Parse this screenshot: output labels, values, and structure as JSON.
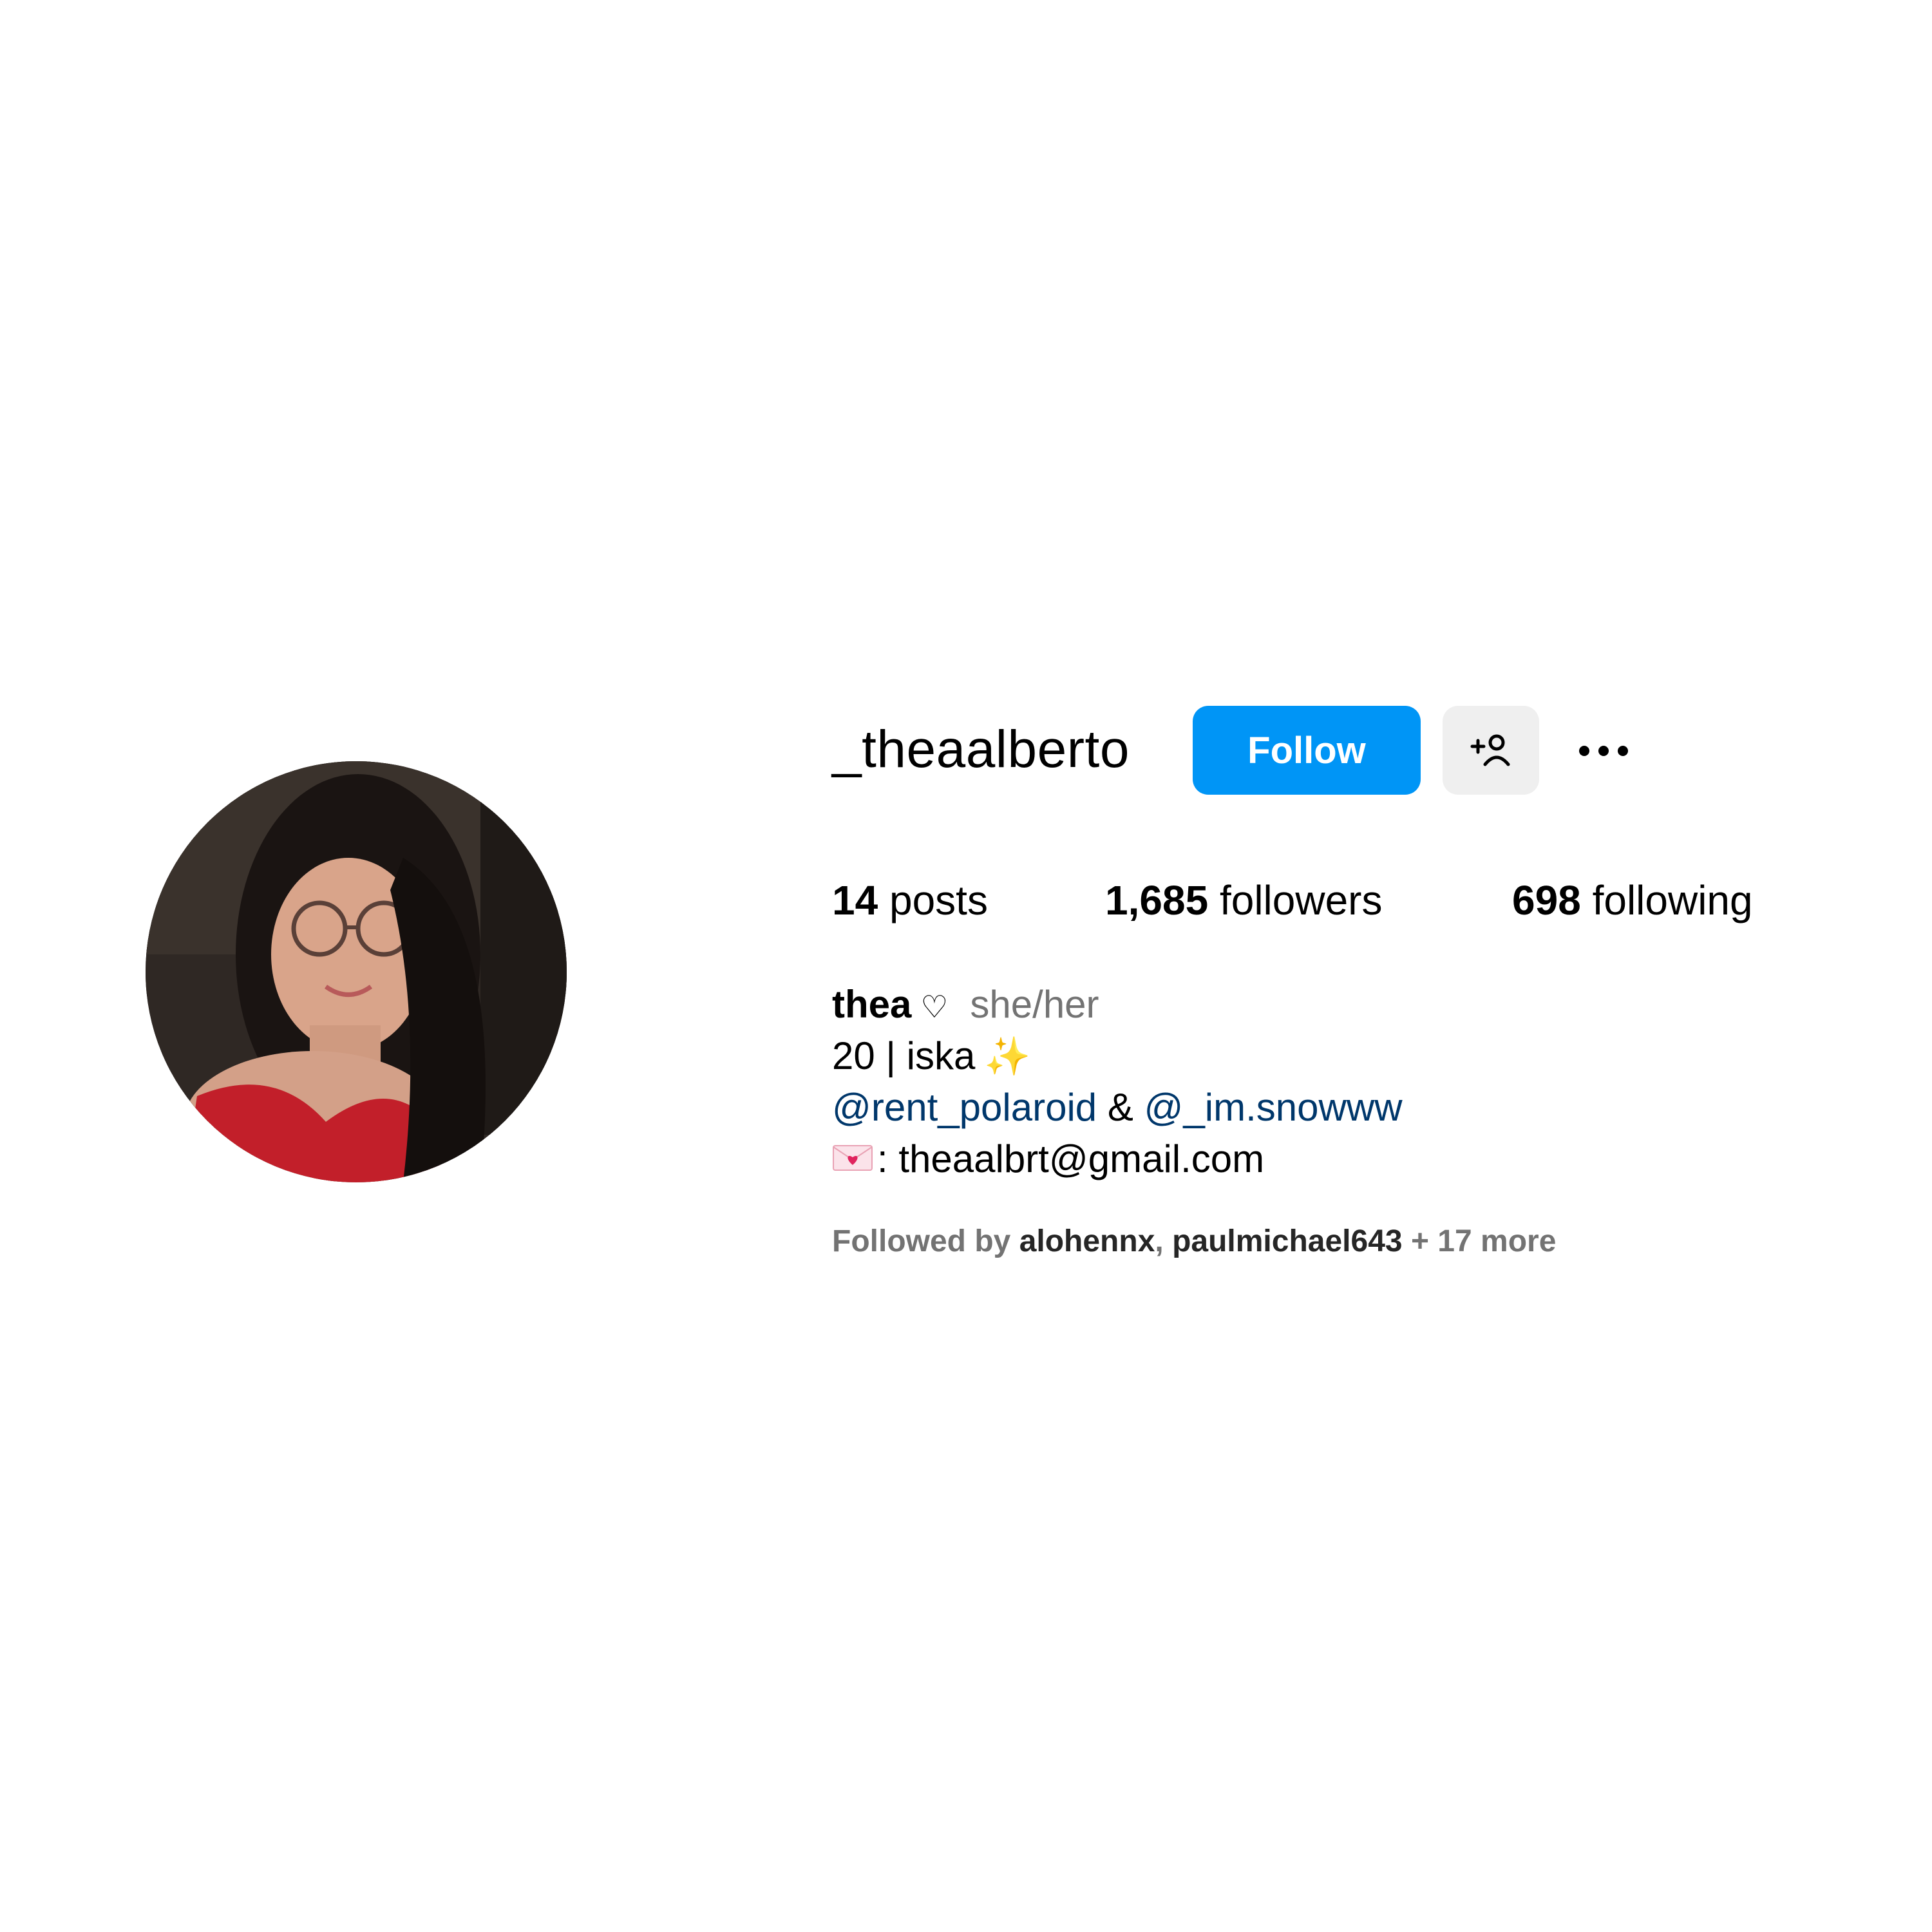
{
  "profile": {
    "username": "_theaalberto",
    "follow_label": "Follow",
    "suggest_icon": "person-add-icon",
    "more_icon": "more-options-icon",
    "avatar_icon": "profile-photo"
  },
  "stats": {
    "posts_count": "14",
    "posts_label": "posts",
    "followers_count": "1,685",
    "followers_label": "followers",
    "following_count": "698",
    "following_label": "following"
  },
  "bio": {
    "display_name": "thea",
    "heart": "♡",
    "pronouns": "she/her",
    "line2": "20 | iska",
    "sparkles": "✨",
    "mention1": "@rent_polaroid",
    "connector": "&",
    "mention2": "@_im.snowww",
    "email_prefix": ":",
    "email": "theaalbrt@gmail.com"
  },
  "followed_by": {
    "prefix": "Followed by",
    "user1": "alohennx",
    "separator": ",",
    "user2": "paulmichael643",
    "more": "+ 17 more"
  },
  "colors": {
    "follow_button": "#0095f6",
    "secondary_button": "#efefef",
    "mention": "#00376b",
    "muted": "#737373"
  }
}
